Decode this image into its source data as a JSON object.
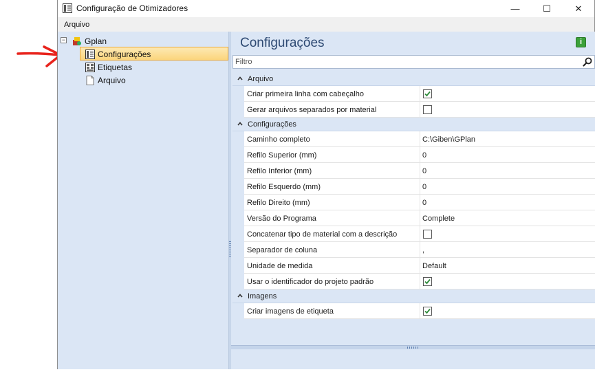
{
  "window": {
    "title": "Configuração de Otimizadores",
    "minimize_glyph": "—",
    "maximize_glyph": "☐",
    "close_glyph": "✕"
  },
  "menubar": {
    "items": [
      "Arquivo"
    ]
  },
  "tree": {
    "root": {
      "label": "Gplan",
      "icon": "gplan-app-icon",
      "expanded": true
    },
    "children": [
      {
        "label": "Configurações",
        "icon": "settings-panel-icon",
        "selected": true
      },
      {
        "label": "Etiquetas",
        "icon": "label-sheet-icon",
        "selected": false
      },
      {
        "label": "Arquivo",
        "icon": "file-icon",
        "selected": false
      }
    ]
  },
  "panel": {
    "title": "Configurações",
    "info_glyph": "i",
    "filter_placeholder": "Filtro"
  },
  "categories": [
    {
      "label": "Arquivo",
      "properties": [
        {
          "name": "Criar primeira linha com cabeçalho",
          "type": "checkbox",
          "checked": true
        },
        {
          "name": "Gerar arquivos separados por material",
          "type": "checkbox",
          "checked": false
        }
      ]
    },
    {
      "label": "Configurações",
      "properties": [
        {
          "name": "Caminho completo",
          "type": "text",
          "value": "C:\\Giben\\GPlan"
        },
        {
          "name": "Refilo Superior (mm)",
          "type": "text",
          "value": "0"
        },
        {
          "name": "Refilo Inferior (mm)",
          "type": "text",
          "value": "0"
        },
        {
          "name": "Refilo Esquerdo (mm)",
          "type": "text",
          "value": "0"
        },
        {
          "name": "Refilo Direito (mm)",
          "type": "text",
          "value": "0"
        },
        {
          "name": "Versão do Programa",
          "type": "text",
          "value": "Complete"
        },
        {
          "name": "Concatenar tipo de material com a descrição",
          "type": "checkbox",
          "checked": false
        },
        {
          "name": "Separador de coluna",
          "type": "text",
          "value": ","
        },
        {
          "name": "Unidade de medida",
          "type": "text",
          "value": "Default"
        },
        {
          "name": "Usar o identificador do projeto padrão",
          "type": "checkbox",
          "checked": true
        }
      ]
    },
    {
      "label": "Imagens",
      "properties": [
        {
          "name": "Criar imagens de etiqueta",
          "type": "checkbox",
          "checked": true
        }
      ]
    }
  ],
  "colors": {
    "accent_arrow": "#e8231c",
    "panel_background": "#dbe6f5",
    "selection_border": "#e8a83a",
    "checkmark": "#2e8b3a"
  }
}
